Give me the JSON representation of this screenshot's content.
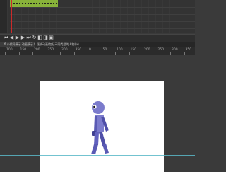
{
  "window": {
    "title": ""
  },
  "timeline": {
    "keyframe_color": "#88b33a",
    "playhead_color": "#cc2a2a"
  },
  "playback_controls": [
    {
      "name": "first-frame",
      "glyph": "⏮"
    },
    {
      "name": "prev-frame",
      "glyph": "◀"
    },
    {
      "name": "play",
      "glyph": "▶"
    },
    {
      "name": "next-frame",
      "glyph": "▶"
    },
    {
      "name": "last-frame",
      "glyph": "⏭"
    },
    {
      "name": "loop",
      "glyph": "↻"
    },
    {
      "name": "onion-skin",
      "glyph": "◧"
    },
    {
      "name": "onion-outline",
      "glyph": "◨"
    },
    {
      "name": "edit-multiple",
      "glyph": "▣"
    }
  ],
  "counter_text": "",
  "document_tabs": [
    {
      "label": "...fl 小代码演示 动画演示 9.fla ×",
      "active": true
    },
    {
      "label": "逐帧动画(包括不同类型的人物) walk.fla ×",
      "active": false
    }
  ],
  "ruler": {
    "labels": [
      "100",
      "150",
      "200",
      "250",
      "300",
      "350",
      "0",
      "50",
      "100",
      "150",
      "200",
      "250",
      "300",
      "350"
    ]
  },
  "stage": {
    "background": "#ffffff",
    "guide_color": "#5ab8c8"
  },
  "character": {
    "color": "#7b7bcc",
    "dark_color": "#4f4fa8"
  }
}
